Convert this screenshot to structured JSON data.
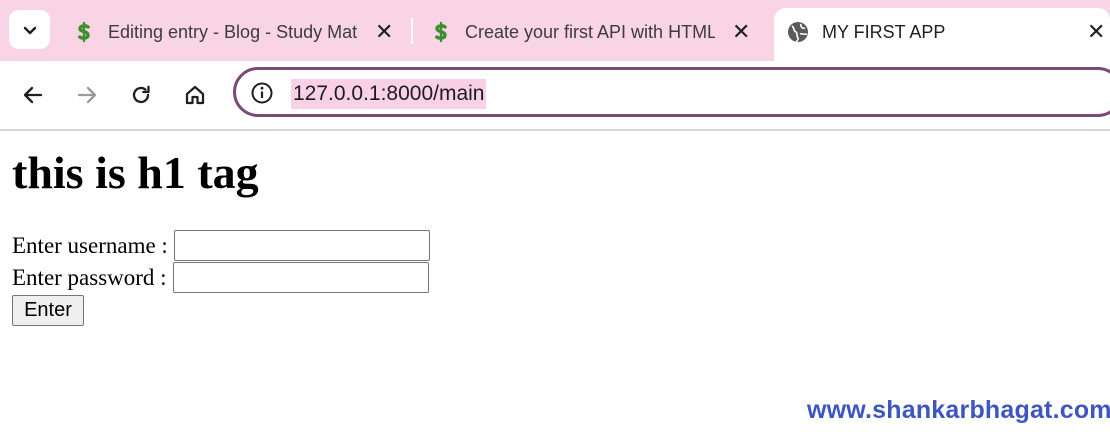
{
  "browser": {
    "tabs": [
      {
        "title": "Editing entry - Blog - Study Mat",
        "favicon": "dollar-icon",
        "active": false
      },
      {
        "title": "Create your first API with HTML",
        "favicon": "dollar-icon",
        "active": false
      },
      {
        "title": "MY FIRST APP",
        "favicon": "globe-icon",
        "active": true
      }
    ],
    "close_glyph": "✕",
    "url": "127.0.0.1:8000/main",
    "colors": {
      "tabstrip": "#f8d4e4",
      "omnibox_border": "#7b4a78",
      "url_highlight": "#f8d1e6"
    }
  },
  "page": {
    "heading": "this is h1 tag",
    "username_label": "Enter username :",
    "password_label": "Enter password :",
    "username_value": "",
    "password_value": "",
    "submit_label": "Enter"
  },
  "watermark": "www.shankarbhagat.com"
}
